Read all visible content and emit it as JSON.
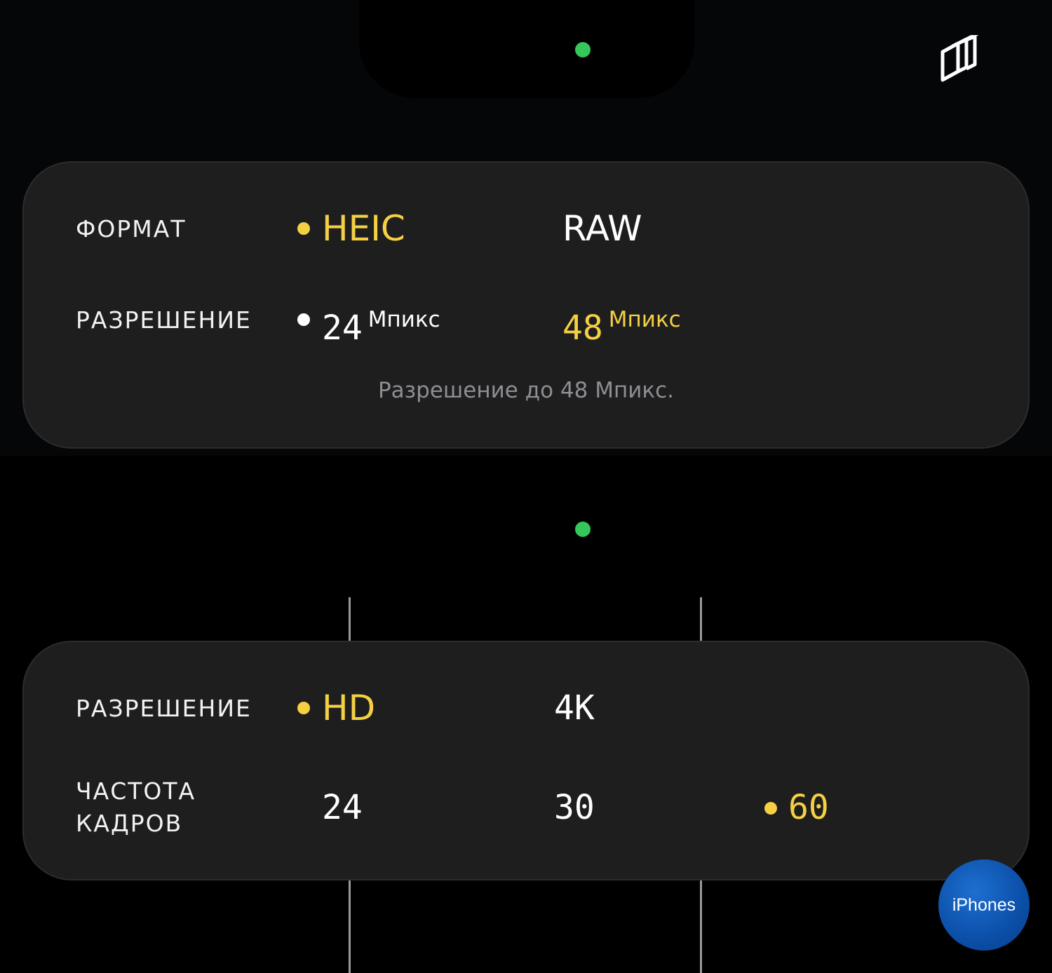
{
  "photo_panel": {
    "format_label": "ФОРМАТ",
    "format_options": [
      {
        "label": "HEIC",
        "selected": true
      },
      {
        "label": "RAW",
        "selected": false
      }
    ],
    "resolution_label": "РАЗРЕШЕНИЕ",
    "resolution_options": [
      {
        "value": "24",
        "unit": "Мпикс",
        "selected": false
      },
      {
        "value": "48",
        "unit": "Мпикс",
        "selected": true
      }
    ],
    "hint": "Разрешение до 48 Мпикс."
  },
  "video_panel": {
    "resolution_label": "РАЗРЕШЕНИЕ",
    "resolution_options": [
      {
        "label": "HD",
        "selected": true
      },
      {
        "label": "4K",
        "selected": false
      }
    ],
    "framerate_label_line1": "ЧАСТОТА",
    "framerate_label_line2": "КАДРОВ",
    "framerate_options": [
      {
        "label": "24",
        "selected": false
      },
      {
        "label": "30",
        "selected": false
      },
      {
        "label": "60",
        "selected": true
      }
    ]
  },
  "icons": {
    "top_right": "stacked-layers-icon",
    "indicator": "camera-in-use-indicator"
  },
  "colors": {
    "selected": "#f5d042",
    "indicator": "#34c759",
    "panel": "#1e1e1f"
  },
  "watermark": "iPhones"
}
